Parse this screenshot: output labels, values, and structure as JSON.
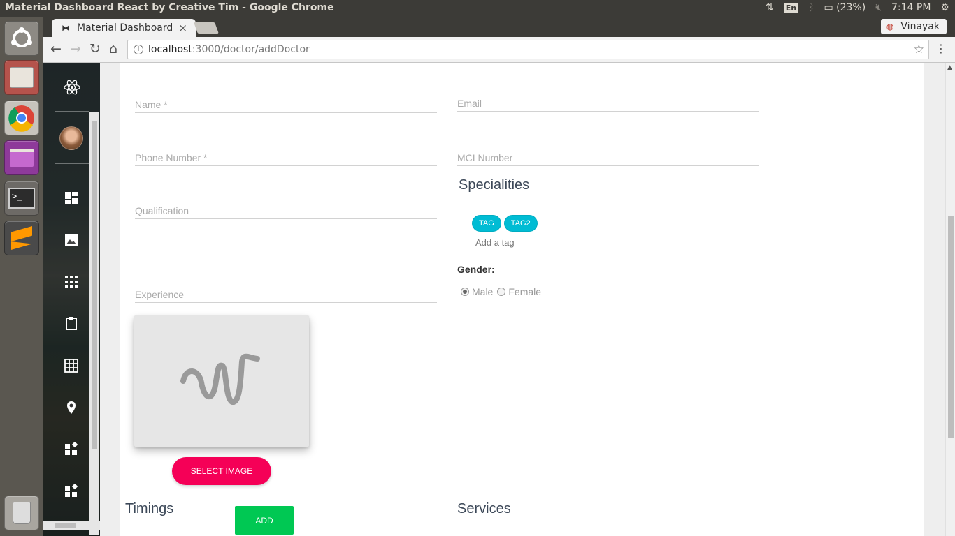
{
  "system": {
    "window_title": "Material Dashboard React by Creative Tim - Google Chrome",
    "keyboard": "En",
    "battery": "(23%)",
    "clock": "7:14 PM"
  },
  "browser": {
    "tab_title": "Material Dashboard",
    "tab_close": "×",
    "profile_name": "Vinayak",
    "url_host": "localhost",
    "url_path": ":3000/doctor/addDoctor"
  },
  "form": {
    "name_label": "Name *",
    "email_label": "Email",
    "phone_label": "Phone Number *",
    "mci_label": "MCI Number",
    "qualification_label": "Qualification",
    "experience_label": "Experience",
    "specialities_title": "Specialities",
    "tags": [
      "TAG",
      "TAG2"
    ],
    "add_tag_placeholder": "Add a tag",
    "gender_label": "Gender:",
    "gender_options": [
      "Male",
      "Female"
    ],
    "gender_selected": "Male",
    "select_image_button": "SELECT IMAGE",
    "timings_title": "Timings",
    "add_button": "ADD",
    "services_title": "Services"
  },
  "colors": {
    "tag": "#00bcd4",
    "select_image": "#f50057",
    "add": "#00c853"
  }
}
